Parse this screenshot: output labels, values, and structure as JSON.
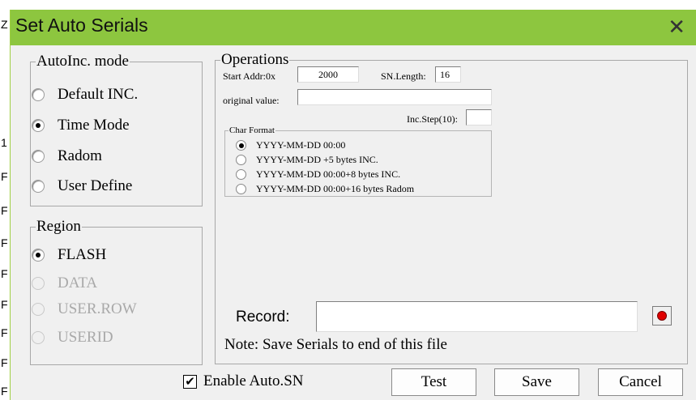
{
  "dialog": {
    "title": "Set Auto Serials",
    "close_glyph": "✕"
  },
  "autoinc": {
    "legend": "AutoInc. mode",
    "options": [
      {
        "label": "Default INC.",
        "selected": false,
        "enabled": true
      },
      {
        "label": "Time Mode",
        "selected": true,
        "enabled": true
      },
      {
        "label": "Radom",
        "selected": false,
        "enabled": true
      },
      {
        "label": "User Define",
        "selected": false,
        "enabled": true
      }
    ]
  },
  "region": {
    "legend": "Region",
    "options": [
      {
        "label": "FLASH",
        "selected": true,
        "enabled": true
      },
      {
        "label": "DATA",
        "selected": false,
        "enabled": false
      },
      {
        "label": "USER.ROW",
        "selected": false,
        "enabled": false
      },
      {
        "label": "USERID",
        "selected": false,
        "enabled": false
      }
    ]
  },
  "operations": {
    "legend": "Operations",
    "start_addr_label": "Start Addr:0x",
    "start_addr_value": "2000",
    "sn_length_label": "SN.Length:",
    "sn_length_value": "16",
    "original_value_label": "original value:",
    "original_value": "",
    "inc_step_label": "Inc.Step(10):",
    "inc_step_value": "",
    "char_format": {
      "legend": "Char Format",
      "options": [
        {
          "label": "YYYY-MM-DD 00:00",
          "selected": true
        },
        {
          "label": "YYYY-MM-DD +5 bytes INC.",
          "selected": false
        },
        {
          "label": "YYYY-MM-DD 00:00+8 bytes INC.",
          "selected": false
        },
        {
          "label": "YYYY-MM-DD 00:00+16 bytes Radom",
          "selected": false
        }
      ]
    },
    "record_label": "Record:",
    "record_value": "",
    "note": "Note: Save Serials to end of this file"
  },
  "footer": {
    "enable_auto_sn_label": "Enable Auto.SN",
    "enable_auto_sn_checked": true,
    "check_glyph": "✔",
    "test_label": "Test",
    "save_label": "Save",
    "cancel_label": "Cancel"
  },
  "background_edge_chars": [
    "Z",
    "1",
    "F",
    "F",
    "F",
    "F",
    "F",
    "F",
    "F",
    "F"
  ],
  "colors": {
    "titlebar": "#8dc63f",
    "record_dot": "#e00000",
    "disabled_text": "#a9a9a9"
  }
}
